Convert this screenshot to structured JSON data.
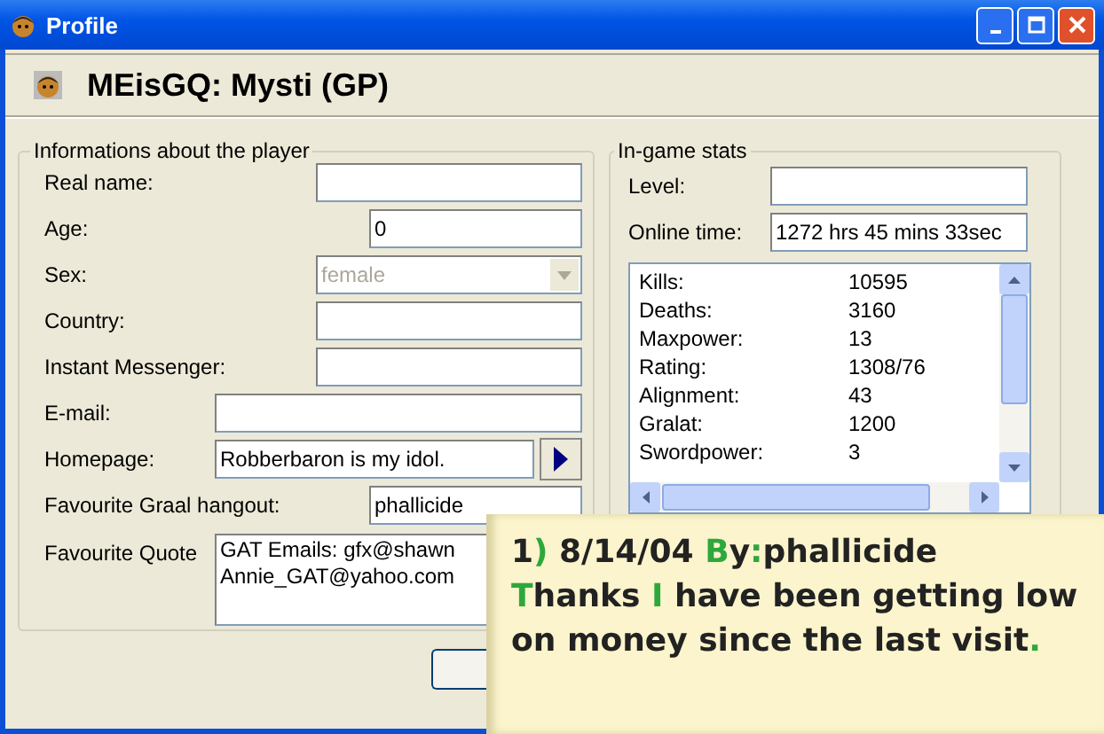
{
  "window": {
    "title": "Profile"
  },
  "header": {
    "title": "MEisGQ: Mysti (GP)"
  },
  "player": {
    "title": "Informations about the player",
    "fields": [
      {
        "kind": "text",
        "label": "Real name:"
      },
      {
        "kind": "text",
        "label": "Age:",
        "value": "0"
      },
      {
        "kind": "combo",
        "label": "Sex:",
        "value": "female",
        "disabled": true
      },
      {
        "kind": "text",
        "label": "Country:"
      },
      {
        "kind": "text",
        "label": "Instant Messenger:"
      },
      {
        "kind": "text",
        "label": "E-mail:"
      },
      {
        "kind": "link",
        "label": "Homepage:",
        "value": "Robberbaron is my idol."
      },
      {
        "kind": "text",
        "label": "Favourite Graal hangout:",
        "value": "phallicide"
      },
      {
        "kind": "memo",
        "label": "Favourite Quote",
        "lines": [
          "GAT Emails: gfx@shawn",
          "Annie_GAT@yahoo.com"
        ]
      }
    ]
  },
  "stats": {
    "title": "In-game stats",
    "fields": [
      {
        "label": "Level:"
      },
      {
        "label": "Online time:",
        "value": "1272 hrs 45 mins 33sec"
      }
    ],
    "rows": [
      {
        "label": "Kills:",
        "value": "10595"
      },
      {
        "label": "Deaths:",
        "value": "3160"
      },
      {
        "label": "Maxpower:",
        "value": "13"
      },
      {
        "label": "Rating:",
        "value": "1308/76"
      },
      {
        "label": "Alignment:",
        "value": "43"
      },
      {
        "label": "Gralat:",
        "value": "1200"
      },
      {
        "label": "Swordpower:",
        "value": "3"
      }
    ]
  },
  "note": {
    "lines": [
      [
        {
          "text": "1",
          "accent": false
        },
        {
          "text": ")",
          "accent": true
        },
        {
          "text": " 8/14/04 ",
          "accent": false
        },
        {
          "text": "B",
          "accent": true
        },
        {
          "text": "y",
          "accent": false
        },
        {
          "text": ":",
          "accent": true
        },
        {
          "text": "phallicide",
          "accent": false
        }
      ],
      [
        {
          "text": "T",
          "accent": true
        },
        {
          "text": "hanks ",
          "accent": false
        },
        {
          "text": "I",
          "accent": true
        },
        {
          "text": " have been getting low",
          "accent": false
        }
      ],
      [
        {
          "text": "on money since the last visit",
          "accent": false
        },
        {
          "text": ".",
          "accent": true
        }
      ]
    ]
  }
}
